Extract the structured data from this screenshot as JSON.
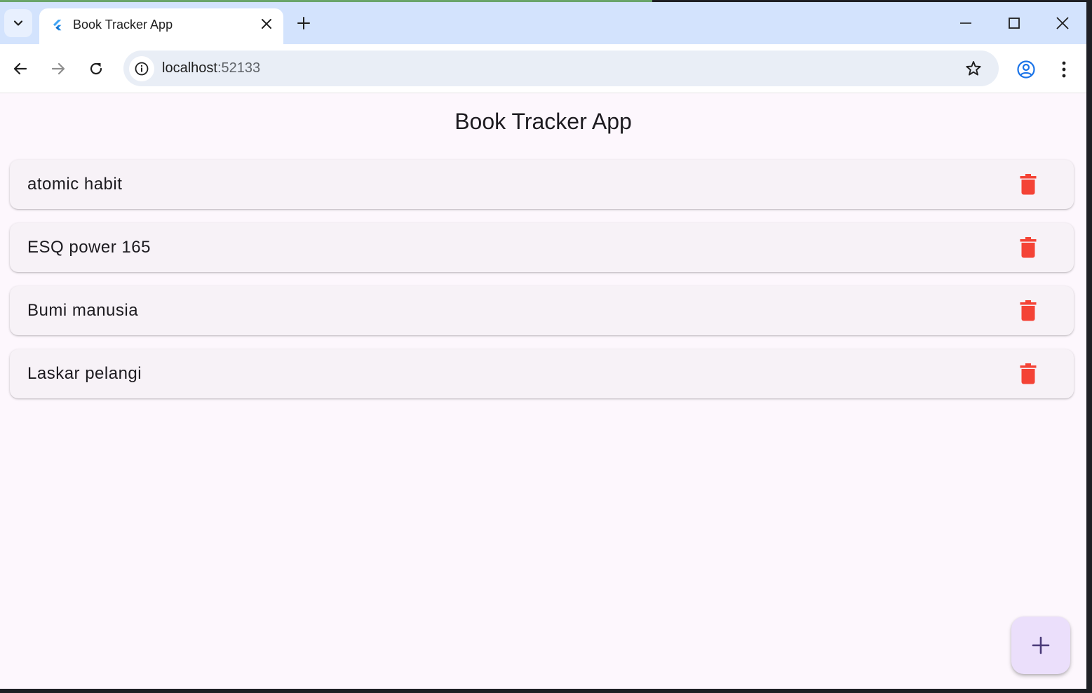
{
  "browser": {
    "tab_title": "Book Tracker App",
    "url_host": "localhost",
    "url_port": ":52133"
  },
  "app": {
    "title": "Book Tracker App",
    "books": [
      {
        "title": "atomic habit"
      },
      {
        "title": "ESQ power 165"
      },
      {
        "title": "Bumi manusia"
      },
      {
        "title": "Laskar pelangi"
      }
    ],
    "add_icon": "plus-icon",
    "delete_icon": "trash-icon"
  },
  "colors": {
    "delete": "#f44336",
    "fab_bg": "#ebdffb",
    "fab_icon": "#4a3a78",
    "page_bg": "#fdf7fd",
    "card_bg": "#f7f2f7",
    "tabstrip": "#d3e3fd"
  }
}
